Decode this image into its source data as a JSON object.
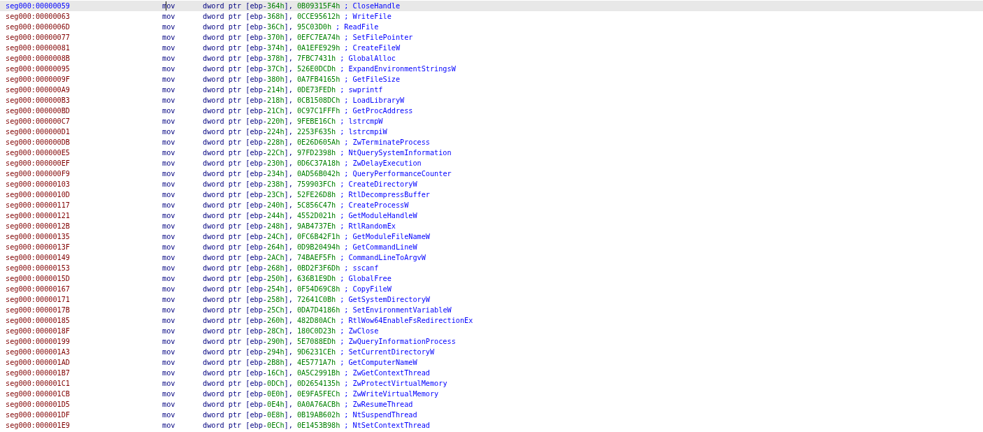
{
  "listing": {
    "rows": [
      {
        "address": "seg000:00000059",
        "mnemonic": "mov",
        "operand": [
          "dword ptr [ebp-",
          "364h",
          "], ",
          "0B09315F4h"
        ],
        "comment": "; CloseHandle",
        "selected": true
      },
      {
        "address": "seg000:00000063",
        "mnemonic": "mov",
        "operand": [
          "dword ptr [ebp-",
          "368h",
          "], ",
          "0CCE95612h"
        ],
        "comment": "; WriteFile",
        "selected": false
      },
      {
        "address": "seg000:0000006D",
        "mnemonic": "mov",
        "operand": [
          "dword ptr [ebp-",
          "36Ch",
          "], ",
          "95C03D0h"
        ],
        "comment": "; ReadFile",
        "selected": false
      },
      {
        "address": "seg000:00000077",
        "mnemonic": "mov",
        "operand": [
          "dword ptr [ebp-",
          "370h",
          "], ",
          "0EFC7EA74h"
        ],
        "comment": "; SetFilePointer",
        "selected": false
      },
      {
        "address": "seg000:00000081",
        "mnemonic": "mov",
        "operand": [
          "dword ptr [ebp-",
          "374h",
          "], ",
          "0A1EFE929h"
        ],
        "comment": "; CreateFileW",
        "selected": false
      },
      {
        "address": "seg000:0000008B",
        "mnemonic": "mov",
        "operand": [
          "dword ptr [ebp-",
          "378h",
          "], ",
          "7FBC7431h"
        ],
        "comment": "; GlobalAlloc",
        "selected": false
      },
      {
        "address": "seg000:00000095",
        "mnemonic": "mov",
        "operand": [
          "dword ptr [ebp-",
          "37Ch",
          "], ",
          "526E0DCDh"
        ],
        "comment": "; ExpandEnvironmentStringsW",
        "selected": false
      },
      {
        "address": "seg000:0000009F",
        "mnemonic": "mov",
        "operand": [
          "dword ptr [ebp-",
          "380h",
          "], ",
          "0A7FB4165h"
        ],
        "comment": "; GetFileSize",
        "selected": false
      },
      {
        "address": "seg000:000000A9",
        "mnemonic": "mov",
        "operand": [
          "dword ptr [ebp-",
          "214h",
          "], ",
          "0DE73FEDh"
        ],
        "comment": "; swprintf",
        "selected": false
      },
      {
        "address": "seg000:000000B3",
        "mnemonic": "mov",
        "operand": [
          "dword ptr [ebp-",
          "218h",
          "], ",
          "0CB1508DCh"
        ],
        "comment": "; LoadLibraryW",
        "selected": false
      },
      {
        "address": "seg000:000000BD",
        "mnemonic": "mov",
        "operand": [
          "dword ptr [ebp-",
          "21Ch",
          "], ",
          "0C97C1FFFh"
        ],
        "comment": "; GetProcAddress",
        "selected": false
      },
      {
        "address": "seg000:000000C7",
        "mnemonic": "mov",
        "operand": [
          "dword ptr [ebp-",
          "220h",
          "], ",
          "9FEBE16Ch"
        ],
        "comment": "; lstrcmpW",
        "selected": false
      },
      {
        "address": "seg000:000000D1",
        "mnemonic": "mov",
        "operand": [
          "dword ptr [ebp-",
          "224h",
          "], ",
          "2253F635h"
        ],
        "comment": "; lstrcmpiW",
        "selected": false
      },
      {
        "address": "seg000:000000DB",
        "mnemonic": "mov",
        "operand": [
          "dword ptr [ebp-",
          "228h",
          "], ",
          "0E26D605Ah"
        ],
        "comment": "; ZwTerminateProcess",
        "selected": false
      },
      {
        "address": "seg000:000000E5",
        "mnemonic": "mov",
        "operand": [
          "dword ptr [ebp-",
          "22Ch",
          "], ",
          "97FD2398h"
        ],
        "comment": "; NtQuerySystemInformation",
        "selected": false
      },
      {
        "address": "seg000:000000EF",
        "mnemonic": "mov",
        "operand": [
          "dword ptr [ebp-",
          "230h",
          "], ",
          "0D6C37A18h"
        ],
        "comment": "; ZwDelayExecution",
        "selected": false
      },
      {
        "address": "seg000:000000F9",
        "mnemonic": "mov",
        "operand": [
          "dword ptr [ebp-",
          "234h",
          "], ",
          "0AD56B042h"
        ],
        "comment": "; QueryPerformanceCounter",
        "selected": false
      },
      {
        "address": "seg000:00000103",
        "mnemonic": "mov",
        "operand": [
          "dword ptr [ebp-",
          "238h",
          "], ",
          "759903FCh"
        ],
        "comment": "; CreateDirectoryW",
        "selected": false
      },
      {
        "address": "seg000:0000010D",
        "mnemonic": "mov",
        "operand": [
          "dword ptr [ebp-",
          "23Ch",
          "], ",
          "52FE26D8h"
        ],
        "comment": "; RtlDecompressBuffer",
        "selected": false
      },
      {
        "address": "seg000:00000117",
        "mnemonic": "mov",
        "operand": [
          "dword ptr [ebp-",
          "240h",
          "], ",
          "5C856C47h"
        ],
        "comment": "; CreateProcessW",
        "selected": false
      },
      {
        "address": "seg000:00000121",
        "mnemonic": "mov",
        "operand": [
          "dword ptr [ebp-",
          "244h",
          "], ",
          "4552D021h"
        ],
        "comment": "; GetModuleHandleW",
        "selected": false
      },
      {
        "address": "seg000:0000012B",
        "mnemonic": "mov",
        "operand": [
          "dword ptr [ebp-",
          "248h",
          "], ",
          "9AB4737Eh"
        ],
        "comment": "; RtlRandomEx",
        "selected": false
      },
      {
        "address": "seg000:00000135",
        "mnemonic": "mov",
        "operand": [
          "dword ptr [ebp-",
          "24Ch",
          "], ",
          "0FC6B42F1h"
        ],
        "comment": "; GetModuleFileNameW",
        "selected": false
      },
      {
        "address": "seg000:0000013F",
        "mnemonic": "mov",
        "operand": [
          "dword ptr [ebp-",
          "264h",
          "], ",
          "0D9B20494h"
        ],
        "comment": "; GetCommandLineW",
        "selected": false
      },
      {
        "address": "seg000:00000149",
        "mnemonic": "mov",
        "operand": [
          "dword ptr [ebp-",
          "2ACh",
          "], ",
          "74BAEF5Fh"
        ],
        "comment": "; CommandLineToArgvW",
        "selected": false
      },
      {
        "address": "seg000:00000153",
        "mnemonic": "mov",
        "operand": [
          "dword ptr [ebp-",
          "268h",
          "], ",
          "0BD2F3F6Dh"
        ],
        "comment": "; sscanf",
        "selected": false
      },
      {
        "address": "seg000:0000015D",
        "mnemonic": "mov",
        "operand": [
          "dword ptr [ebp-",
          "250h",
          "], ",
          "636B1E9Dh"
        ],
        "comment": "; GlobalFree",
        "selected": false
      },
      {
        "address": "seg000:00000167",
        "mnemonic": "mov",
        "operand": [
          "dword ptr [ebp-",
          "254h",
          "], ",
          "0F54D69C8h"
        ],
        "comment": "; CopyFileW",
        "selected": false
      },
      {
        "address": "seg000:00000171",
        "mnemonic": "mov",
        "operand": [
          "dword ptr [ebp-",
          "258h",
          "], ",
          "72641C0Bh"
        ],
        "comment": "; GetSystemDirectoryW",
        "selected": false
      },
      {
        "address": "seg000:0000017B",
        "mnemonic": "mov",
        "operand": [
          "dword ptr [ebp-",
          "25Ch",
          "], ",
          "0DA7D4186h"
        ],
        "comment": "; SetEnvironmentVariableW",
        "selected": false
      },
      {
        "address": "seg000:00000185",
        "mnemonic": "mov",
        "operand": [
          "dword ptr [ebp-",
          "260h",
          "], ",
          "482D80ACh"
        ],
        "comment": "; RtlWow64EnableFsRedirectionEx",
        "selected": false
      },
      {
        "address": "seg000:0000018F",
        "mnemonic": "mov",
        "operand": [
          "dword ptr [ebp-",
          "28Ch",
          "], ",
          "180C0D23h"
        ],
        "comment": "; ZwClose",
        "selected": false
      },
      {
        "address": "seg000:00000199",
        "mnemonic": "mov",
        "operand": [
          "dword ptr [ebp-",
          "290h",
          "], ",
          "5E7088EDh"
        ],
        "comment": "; ZwQueryInformationProcess",
        "selected": false
      },
      {
        "address": "seg000:000001A3",
        "mnemonic": "mov",
        "operand": [
          "dword ptr [ebp-",
          "294h",
          "], ",
          "9D6231CEh"
        ],
        "comment": "; SetCurrentDirectoryW",
        "selected": false
      },
      {
        "address": "seg000:000001AD",
        "mnemonic": "mov",
        "operand": [
          "dword ptr [ebp-",
          "2B8h",
          "], ",
          "4E5771A7h"
        ],
        "comment": "; GetComputerNameW",
        "selected": false
      },
      {
        "address": "seg000:000001B7",
        "mnemonic": "mov",
        "operand": [
          "dword ptr [ebp-",
          "16Ch",
          "], ",
          "0A5C2991Bh"
        ],
        "comment": "; ZwGetContextThread",
        "selected": false
      },
      {
        "address": "seg000:000001C1",
        "mnemonic": "mov",
        "operand": [
          "dword ptr [ebp-",
          "0DCh",
          "], ",
          "0D2654135h"
        ],
        "comment": "; ZwProtectVirtualMemory",
        "selected": false
      },
      {
        "address": "seg000:000001CB",
        "mnemonic": "mov",
        "operand": [
          "dword ptr [ebp-",
          "0E0h",
          "], ",
          "0E9FA5FECh"
        ],
        "comment": "; ZwWriteVirtualMemory",
        "selected": false
      },
      {
        "address": "seg000:000001D5",
        "mnemonic": "mov",
        "operand": [
          "dword ptr [ebp-",
          "0E4h",
          "], ",
          "0A0A76ACBh"
        ],
        "comment": "; ZwResumeThread",
        "selected": false
      },
      {
        "address": "seg000:000001DF",
        "mnemonic": "mov",
        "operand": [
          "dword ptr [ebp-",
          "0E8h",
          "], ",
          "0B19AB602h"
        ],
        "comment": "; NtSuspendThread",
        "selected": false
      },
      {
        "address": "seg000:000001E9",
        "mnemonic": "mov",
        "operand": [
          "dword ptr [ebp-",
          "0ECh",
          "], ",
          "0E1453B98h"
        ],
        "comment": "; NtSetContextThread",
        "selected": false
      }
    ]
  }
}
